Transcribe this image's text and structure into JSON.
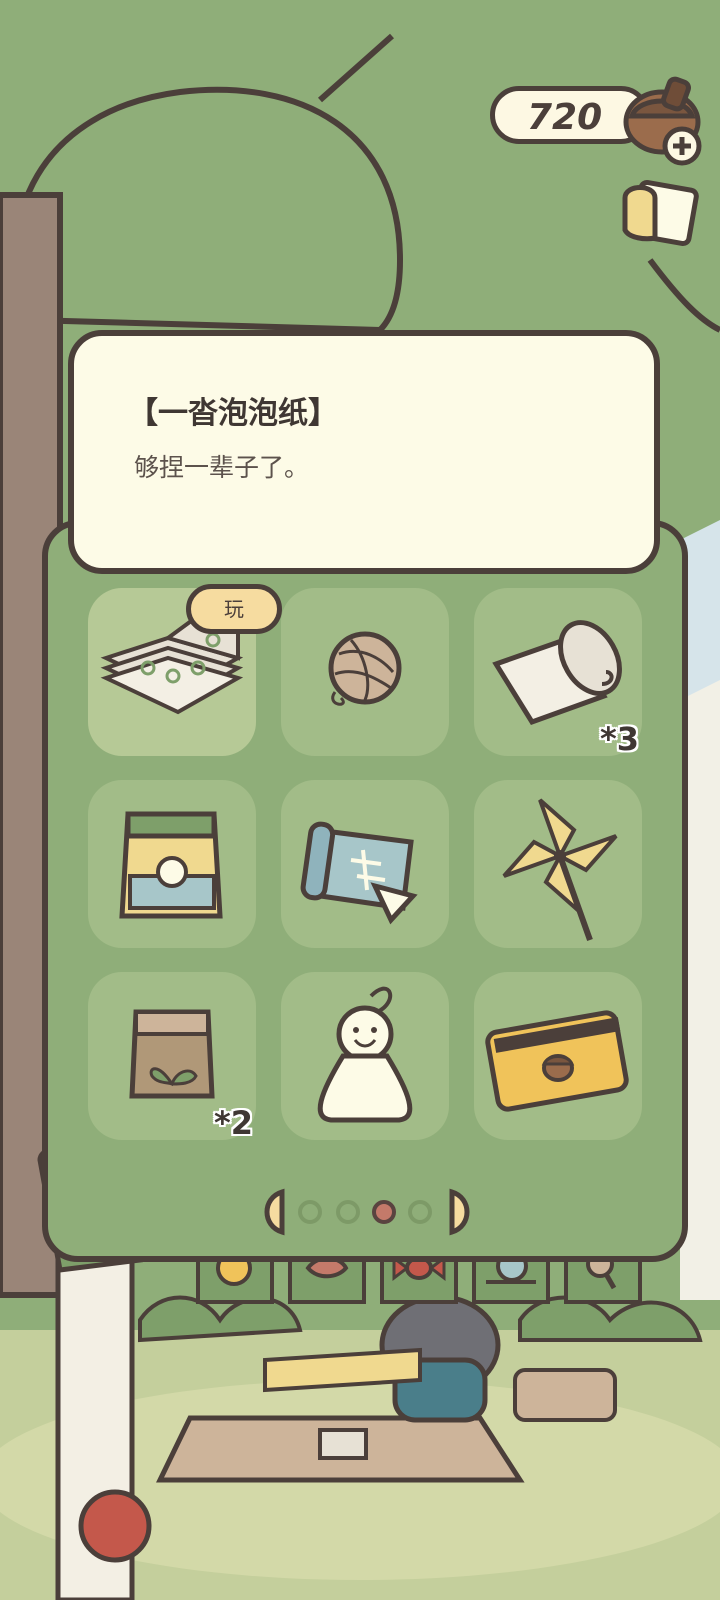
{
  "header": {
    "currency_value": "720",
    "currency_icon": "acorn-icon",
    "add_icon": "plus-icon",
    "mail_icon": "letter-icon"
  },
  "item_detail": {
    "title": "【一沓泡泡纸】",
    "description": "够捏一辈子了。"
  },
  "inventory": {
    "play_label": "玩",
    "slots": [
      {
        "icon": "bubble-wrap-icon",
        "count": ""
      },
      {
        "icon": "yarn-ball-icon",
        "count": ""
      },
      {
        "icon": "paper-roll-icon",
        "count": "*3"
      },
      {
        "icon": "snack-bag-icon",
        "count": ""
      },
      {
        "icon": "map-scroll-icon",
        "count": ""
      },
      {
        "icon": "pinwheel-icon",
        "count": ""
      },
      {
        "icon": "seed-bag-icon",
        "count": "*2"
      },
      {
        "icon": "teru-teru-bozu-icon",
        "count": ""
      },
      {
        "icon": "acorn-card-icon",
        "count": ""
      }
    ],
    "pagination": {
      "pages": 4,
      "current": 3
    }
  },
  "bottom_tabs": [
    "yarn-ball-icon",
    "leaf-icon",
    "candy-icon",
    "snail-icon",
    "magnifier-icon"
  ],
  "colors": {
    "background": "#8fae79",
    "panel": "#8fae79",
    "slot": "#a2bc88",
    "card": "#fdfbe7",
    "outline": "#4b3f3a",
    "accent": "#f6dca0",
    "active_dot": "#c47a6a"
  }
}
